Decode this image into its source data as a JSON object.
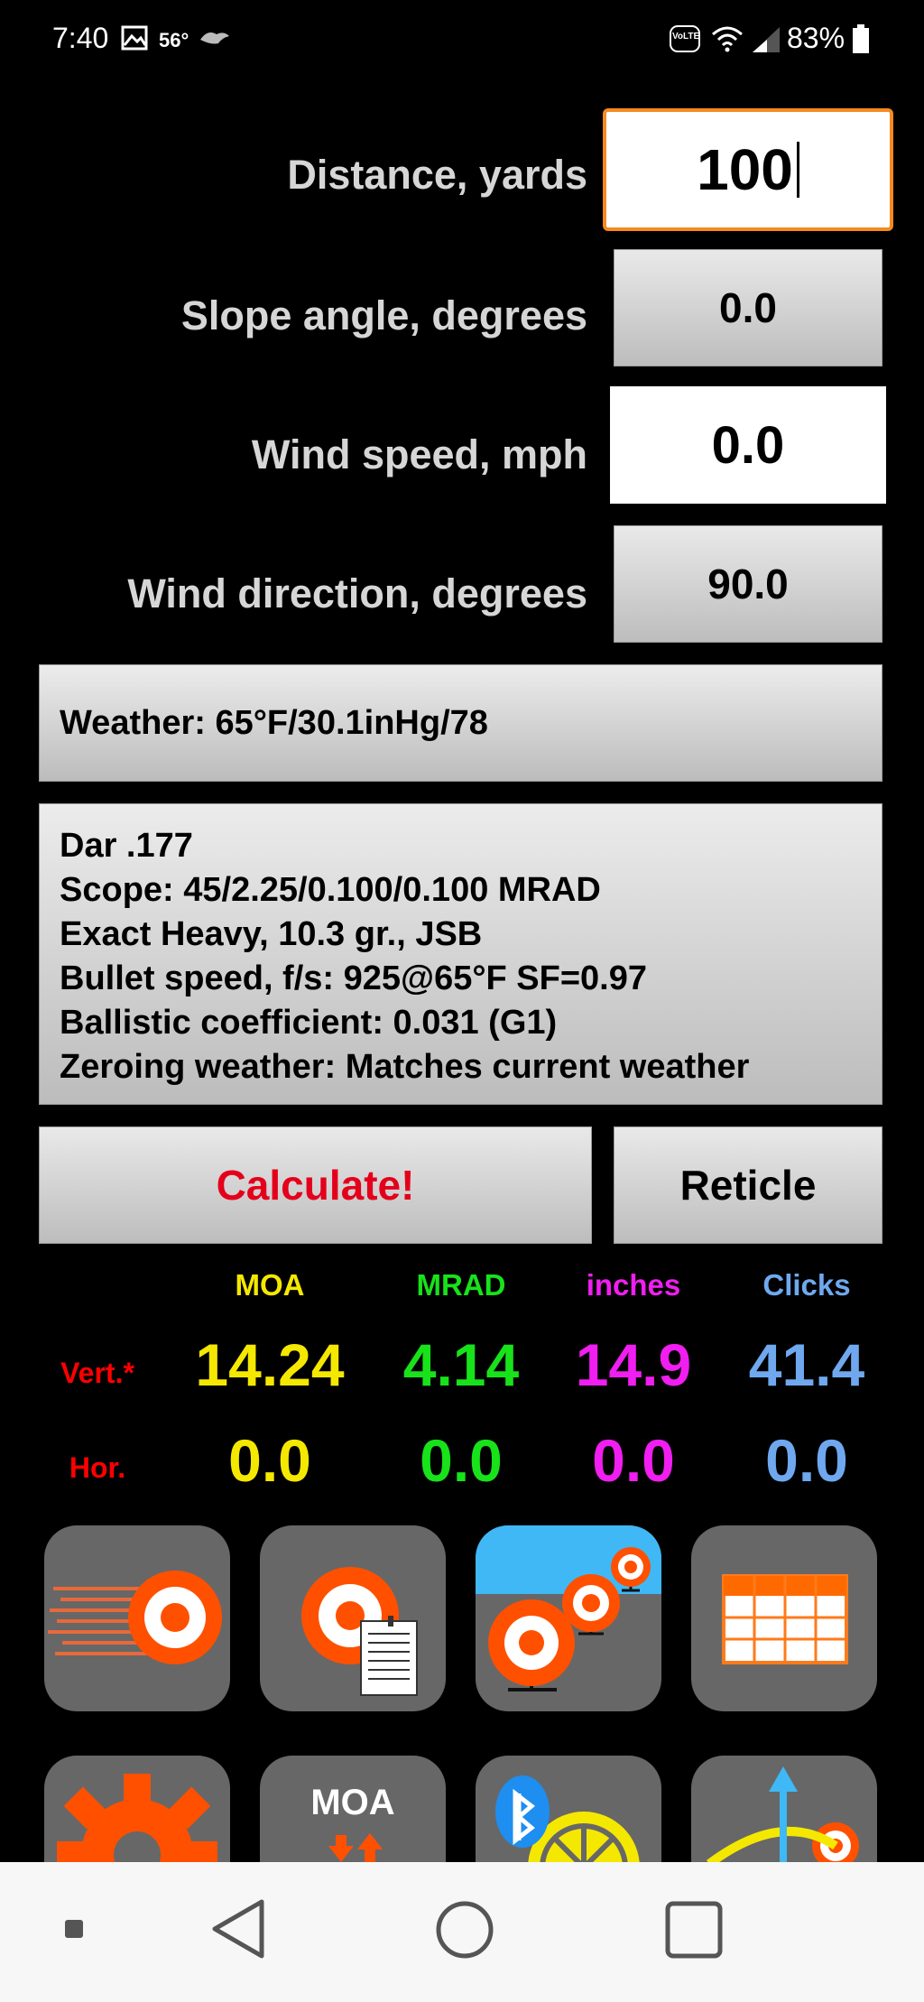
{
  "status_bar": {
    "time": "7:40",
    "temp": "56°",
    "volte": "VoLTE",
    "battery": "83%",
    "icons": [
      "gallery-icon",
      "ravens-logo-icon",
      "volte-icon",
      "wifi-icon",
      "signal-icon",
      "battery-icon"
    ]
  },
  "fields": {
    "distance": {
      "label": "Distance, yards",
      "value": "100"
    },
    "slope": {
      "label": "Slope angle, degrees",
      "value": "0.0"
    },
    "wind_speed": {
      "label": "Wind speed, mph",
      "value": "0.0"
    },
    "wind_direction": {
      "label": "Wind direction, degrees",
      "value": "90.0"
    }
  },
  "weather": {
    "text": "Weather: 65°F/30.1inHg/78"
  },
  "profile": {
    "lines": [
      "Dar .177",
      "Scope: 45/2.25/0.100/0.100 MRAD",
      "Exact Heavy, 10.3 gr., JSB",
      "Bullet speed, f/s: 925@65°F SF=0.97",
      "Ballistic coefficient: 0.031 (G1)",
      "Zeroing weather: Matches current weather"
    ]
  },
  "actions": {
    "calculate": "Calculate!",
    "reticle": "Reticle"
  },
  "results": {
    "headers": [
      "MOA",
      "MRAD",
      "inches",
      "Clicks"
    ],
    "header_colors": [
      "#f5e800",
      "#18e21a",
      "#f01ef0",
      "#6fa8ef"
    ],
    "rows": [
      {
        "label": "Vert.*",
        "values": [
          "14.24",
          "4.14",
          "14.9",
          "41.4"
        ]
      },
      {
        "label": "Hor.",
        "values": [
          "0.0",
          "0.0",
          "0.0",
          "0.0"
        ]
      }
    ]
  },
  "tiles": {
    "row1": [
      "speed-target-icon",
      "target-document-icon",
      "multi-range-targets-icon",
      "table-icon"
    ],
    "row2": [
      {
        "icon": "settings-gear-icon",
        "label": ""
      },
      {
        "icon": "moa-convert-icon",
        "label": "MOA"
      },
      {
        "icon": "bluetooth-weather-icon",
        "label": ""
      },
      {
        "icon": "trajectory-target-icon",
        "label": ""
      }
    ]
  },
  "colors": {
    "accent_orange": "#f58a1f",
    "tile_orange": "#ff5000",
    "calculate_red": "#e4001b"
  }
}
